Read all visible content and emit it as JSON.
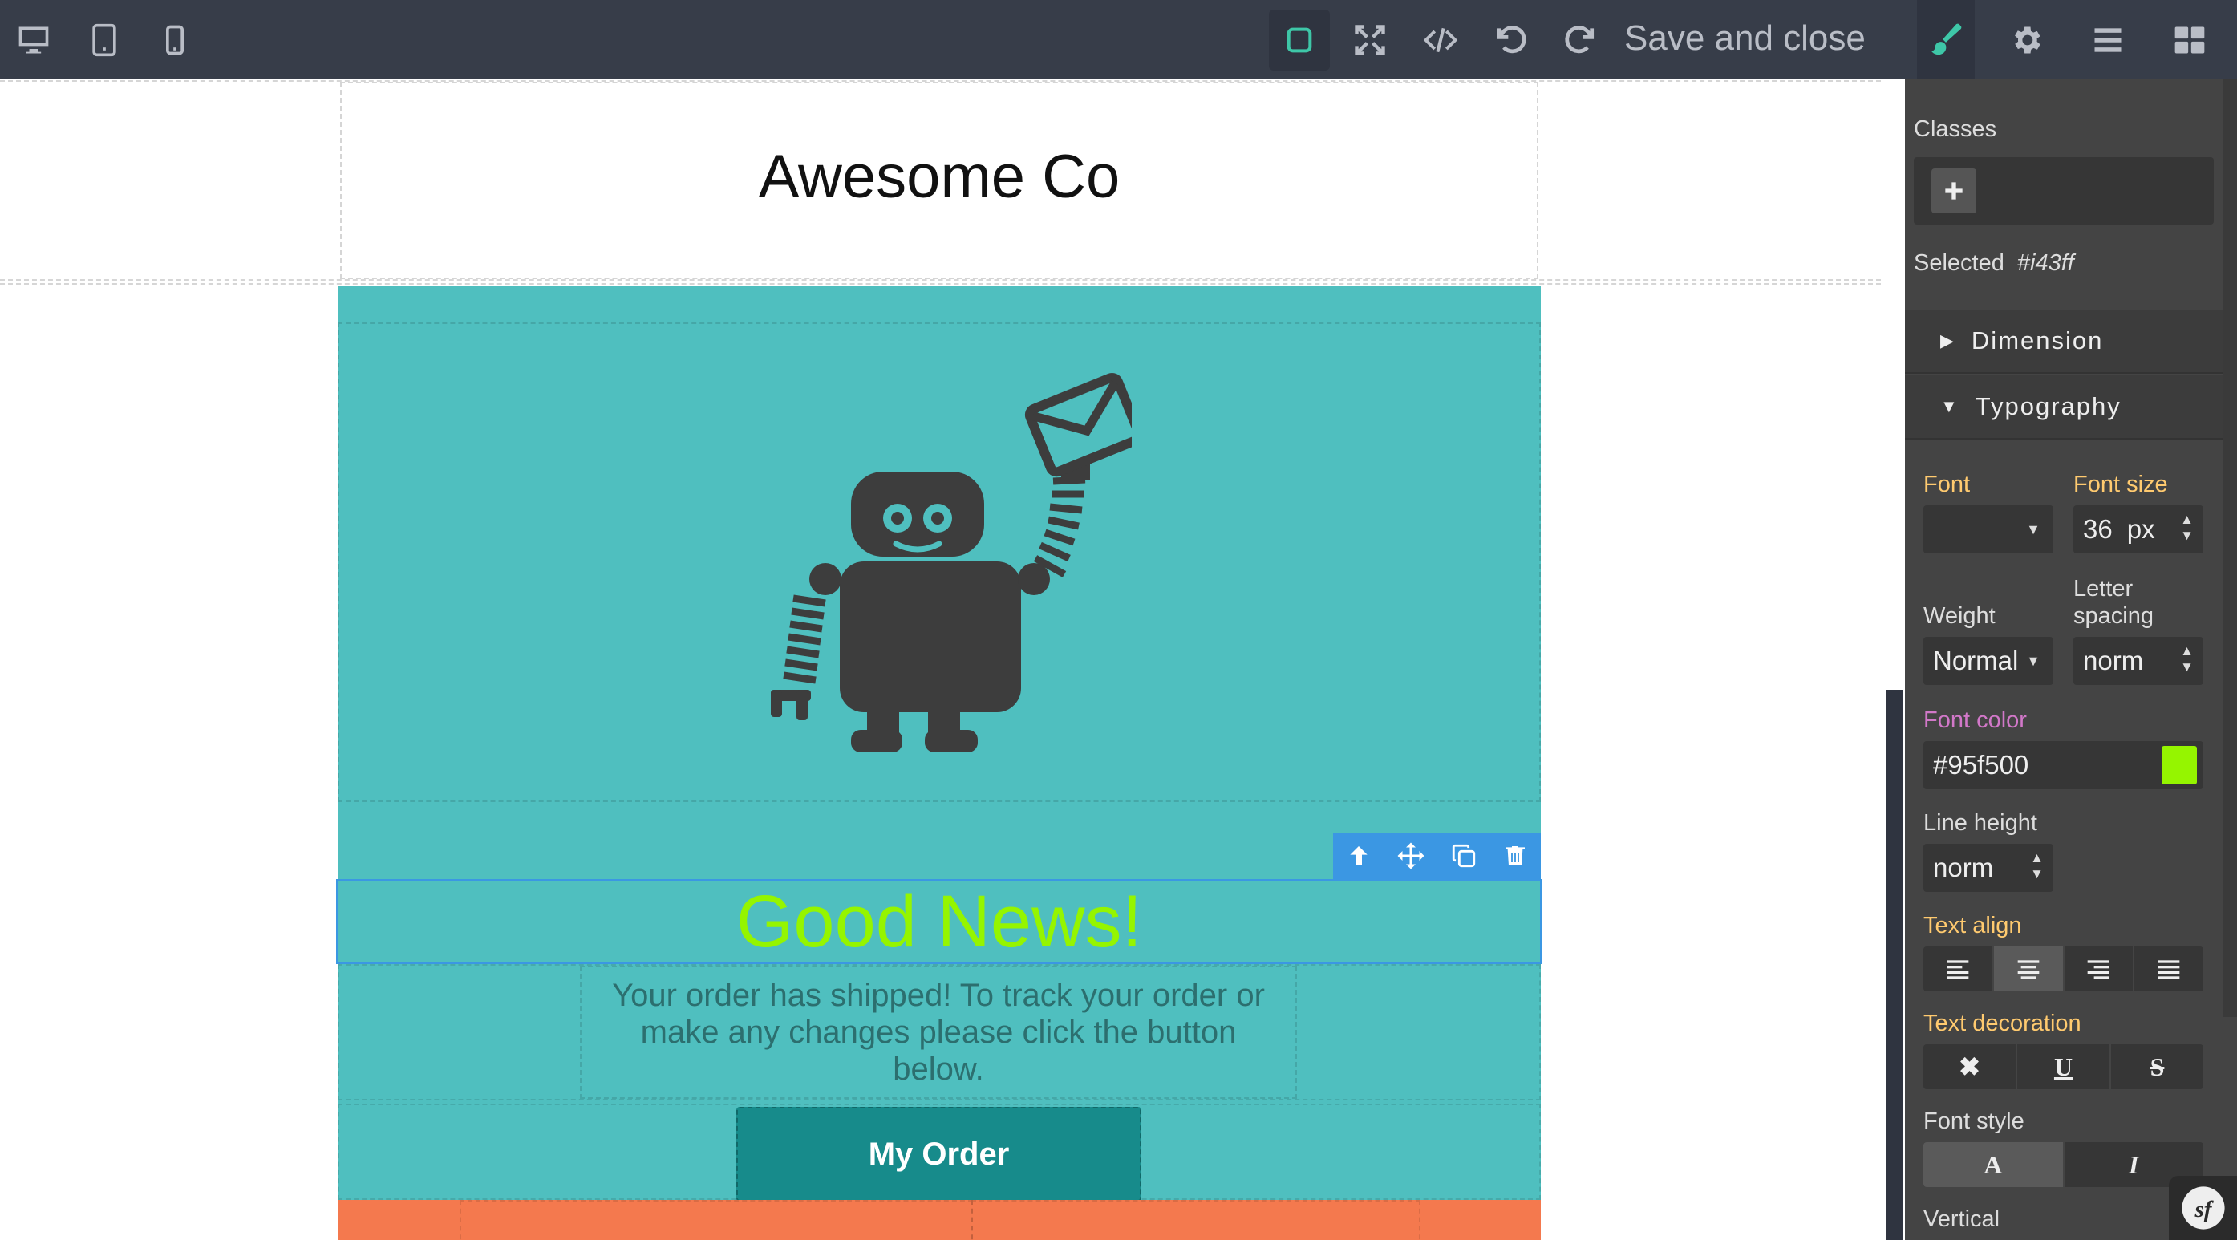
{
  "toolbar": {
    "save_label": "Save and close",
    "devices": [
      "desktop-icon",
      "tablet-icon",
      "mobile-icon"
    ],
    "actions": [
      "outline-icon",
      "fullscreen-icon",
      "code-icon",
      "undo-icon",
      "redo-icon"
    ],
    "panel_tabs": [
      "brush-icon",
      "gear-icon",
      "layers-icon",
      "blocks-icon"
    ]
  },
  "email": {
    "company": "Awesome Co",
    "headline": "Good News!",
    "body": "Your order has shipped! To track your order or make any changes please click the button below.",
    "cta": "My Order",
    "colors": {
      "teal": "#4fbfbf",
      "button": "#178b8b",
      "headline": "#95f500",
      "footer": "#f4794e"
    }
  },
  "panel": {
    "classes_label": "Classes",
    "selected_label": "Selected",
    "selected_id": "#i43ff",
    "sectors": {
      "dimension": "Dimension",
      "typography": "Typography"
    },
    "typography": {
      "font_label": "Font",
      "font_value": "",
      "font_size_label": "Font size",
      "font_size_value": "36",
      "font_size_unit": "px",
      "weight_label": "Weight",
      "weight_value": "Normal",
      "letter_spacing_label_1": "Letter",
      "letter_spacing_label_2": "spacing",
      "letter_spacing_value": "norm",
      "font_color_label": "Font color",
      "font_color_value": "#95f500",
      "line_height_label": "Line height",
      "line_height_value": "norm",
      "text_align_label": "Text align",
      "text_decoration_label": "Text decoration",
      "font_style_label": "Font style",
      "vertical_label": "Vertical"
    }
  }
}
